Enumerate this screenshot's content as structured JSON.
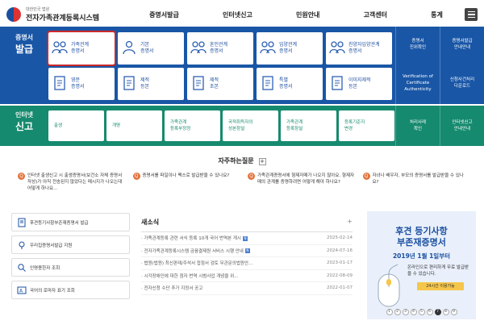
{
  "header": {
    "logo_sub": "대한민국 법원",
    "logo_title": "전자가족관계등록시스템",
    "nav": [
      "증명서발급",
      "인터넷신고",
      "민원안내",
      "고객센터",
      "통계"
    ]
  },
  "cert_section": {
    "label_a": "증명서",
    "label_b": "발급",
    "tiles": [
      "가족관계\n증명서",
      "기본\n증명서",
      "혼인관계\n증명서",
      "입양관계\n증명서",
      "친양자입양관계\n증명서",
      "영문\n증명서",
      "제적\n등본",
      "제적\n초본",
      "특별\n증명서",
      "이미지제적\n등본"
    ],
    "side": [
      "증명서\n진위확인",
      "증명서발급\n안내안내",
      "Verification of\nCertificate\nAuthenticity",
      "신청사건처리\n다운로드"
    ]
  },
  "report_section": {
    "label_a": "인터넷",
    "label_b": "신고",
    "tiles": [
      "출생",
      "개명",
      "가족관계\n등록부정정",
      "국적취득자의\n성본창설",
      "가족관계\n등록창설",
      "등록기준지\n변경"
    ],
    "side": [
      "처리사례\n확인",
      "인터넷신고\n안내안내"
    ]
  },
  "faq": {
    "title": "자주하는질문",
    "items": [
      "인터넷 출생신고 시 출생증명서(보건소 자체 증명서 작성)가 아직 전송된지 않았다는 메시지가 나오는데 어떻게 하나요...",
      "증명서를 파일이나 팩스로 발급받을 수 있나요?",
      "가족관계증명서에 형제자매가 나오지 않아요. 형제자매의 관계를 증명하려면 어떻게 해야 하나요?",
      "자녀나 배우자, 부모의 증명서를 발급받을 수 있나요?"
    ]
  },
  "links": [
    "후견등기사항부존재증명서 발급",
    "우리집증명서발급 지원",
    "인명용한자 조회",
    "국어의 로마자 표기 조회"
  ],
  "news": {
    "title": "새소식",
    "more": "+",
    "rows": [
      {
        "t": "가족관계등록 관련 서식 등록 10개 국어 번역본 게시",
        "d": "2025-02-14",
        "n": true
      },
      {
        "t": "전자가족관계등록시스템 금융결제원 서비스 시행 안내",
        "d": "2024-07-16",
        "n": true
      },
      {
        "t": "법원(법원) 최신판례/주석서 접점서 검토 무관문의법원안...",
        "d": "2023-01-17",
        "n": false
      },
      {
        "t": "시각장애인에 대한 점자 번역 시범사업 개념을 위...",
        "d": "2022-08-09",
        "n": false
      },
      {
        "t": "전자신청 수단 추가 지정서 공고",
        "d": "2022-01-07",
        "n": false
      }
    ]
  },
  "banner": {
    "title_1": "후견 등기사항",
    "title_2": "부존재증명서",
    "title_3": "2019년 1월 1일부터",
    "desc": "온라인으로 편리하게 무료 발급받을 수 있습니다.",
    "tag": "24시간 이용가능"
  },
  "pager": [
    "1",
    "2",
    "3",
    "4",
    "5",
    "6",
    "7",
    "8",
    "9"
  ],
  "pager_active_index": 6,
  "colors": {
    "blue_band": "#1956a6",
    "green_band": "#168a6e",
    "selected_outline": "#c92a2a"
  }
}
